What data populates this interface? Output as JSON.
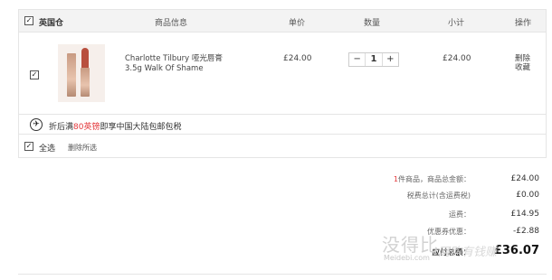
{
  "header": {
    "warehouse": "英国仓",
    "col_product": "商品信息",
    "col_price": "单价",
    "col_qty": "数量",
    "col_subtotal": "小计",
    "col_ops": "操作"
  },
  "item": {
    "name_line1": "Charlotte Tilbury 哑光唇膏",
    "name_line2": "3.5g Walk Of Shame",
    "price": "£24.00",
    "qty_minus": "−",
    "quantity": "1",
    "qty_plus": "+",
    "subtotal": "£24.00",
    "op_delete": "删除",
    "op_favorite": "收藏"
  },
  "promo": {
    "icon": "airplane-icon",
    "text_before": "折后满",
    "text_highlight": "80英镑",
    "text_after": "即享中国大陆包邮包税"
  },
  "footer": {
    "select_all": "全选",
    "delete_selected": "删除所选"
  },
  "summary": {
    "count": "1",
    "items_label": "件商品，商品总金额：",
    "items_total": "£24.00",
    "tax_label": "税费总计(含运费税)",
    "tax_value": "£0.00",
    "shipping_label": "运费：",
    "shipping_value": "£14.95",
    "coupon_label": "优惠券优惠：",
    "coupon_value": "-£2.88",
    "payable_label": "应付总额：",
    "payable_value": "£36.07"
  },
  "watermark": {
    "brand": "没得比",
    "domain": "Meidebi.com",
    "slogan": "网购有钱赚"
  },
  "colors": {
    "accent_red": "#e4393c",
    "header_bg": "#f3f3f3"
  }
}
